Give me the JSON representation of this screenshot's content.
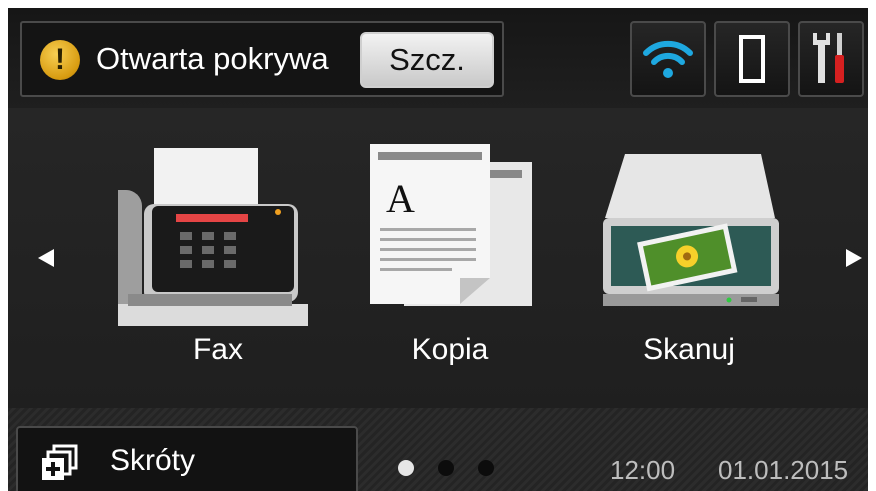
{
  "status": {
    "message": "Otwarta pokrywa",
    "action_label": "Szcz.",
    "icon": "warning-icon"
  },
  "toolbar_icons": [
    "wifi-icon",
    "toner-icon",
    "settings-tools-icon"
  ],
  "apps": [
    {
      "label": "Fax",
      "icon": "fax-icon"
    },
    {
      "label": "Kopia",
      "icon": "copy-icon"
    },
    {
      "label": "Skanuj",
      "icon": "scanner-icon"
    }
  ],
  "shortcuts": {
    "label": "Skróty",
    "icon": "shortcuts-icon"
  },
  "pagination": {
    "pages": 3,
    "active": 1
  },
  "clock": {
    "time": "12:00",
    "date": "01.01.2015"
  },
  "colors": {
    "wifi": "#1ea8e0",
    "warning": "#e8b020",
    "screen_bg": "#222222"
  }
}
